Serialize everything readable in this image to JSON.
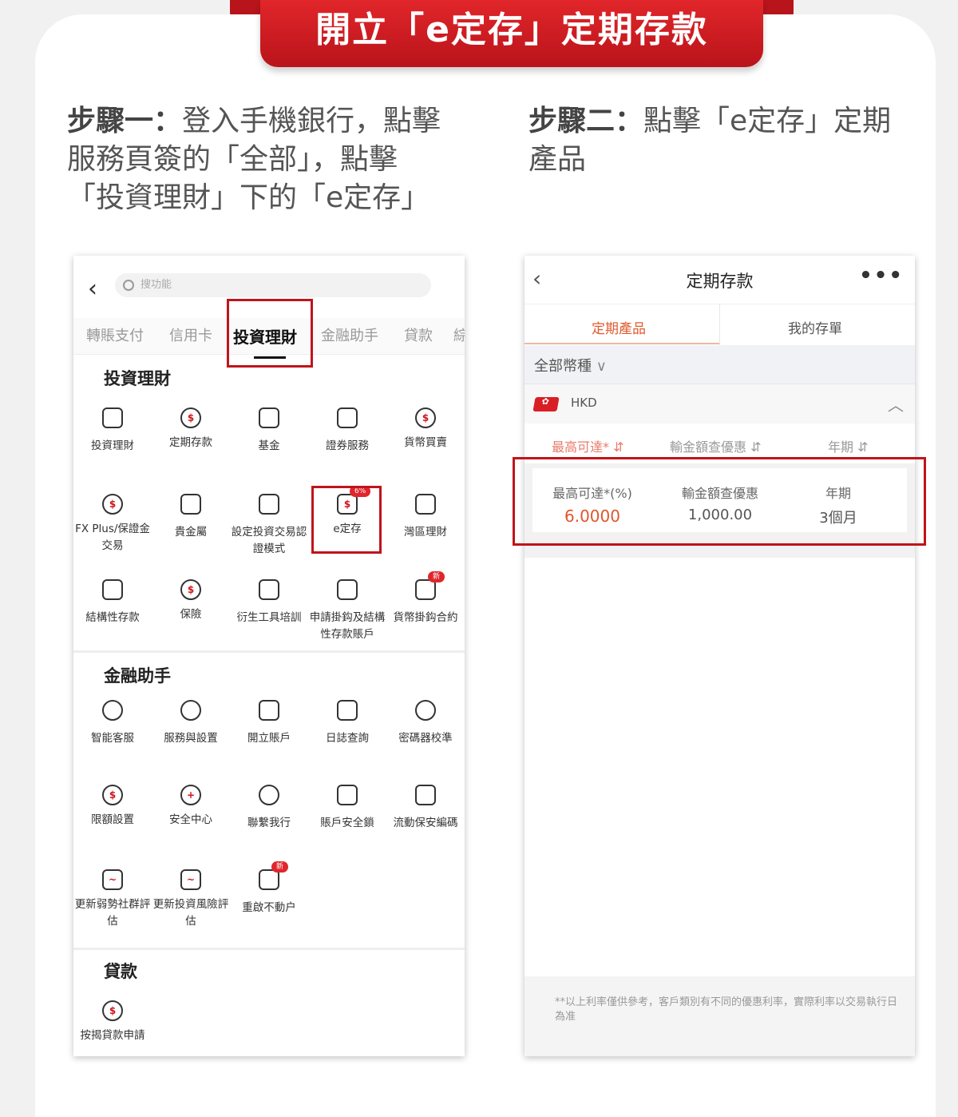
{
  "banner": {
    "title": "開立「e定存」定期存款"
  },
  "steps": [
    {
      "label": "步驟一：",
      "text": "登入手機銀行，點擊服務頁簽的「全部」，點擊「投資理財」下的「e定存」"
    },
    {
      "label": "步驟二：",
      "text": "點擊「e定存」定期產品"
    }
  ],
  "phone1": {
    "search_placeholder": "搜功能",
    "tabs": [
      "轉賬支付",
      "信用卡",
      "投資理財",
      "金融助手",
      "貸款",
      "綜"
    ],
    "sections": [
      {
        "title": "投資理財",
        "items": [
          {
            "label": "投資理財",
            "icon": "wallet-icon"
          },
          {
            "label": "定期存款",
            "icon": "timer-icon"
          },
          {
            "label": "基金",
            "icon": "chart-icon"
          },
          {
            "label": "證券服務",
            "icon": "trend-icon"
          },
          {
            "label": "貨幣買賣",
            "icon": "exchange-icon"
          },
          {
            "label": "FX Plus/保證金交易",
            "icon": "shield-dollar-icon"
          },
          {
            "label": "貴金屬",
            "icon": "gold-bars-icon"
          },
          {
            "label": "設定投資交易認證模式",
            "icon": "settings-card-icon"
          },
          {
            "label": "e定存",
            "icon": "calendar-dollar-icon",
            "badge": "6%"
          },
          {
            "label": "灣區理財",
            "icon": "bay-icon"
          },
          {
            "label": "結構性存款",
            "icon": "box-icon"
          },
          {
            "label": "保險",
            "icon": "insurance-icon"
          },
          {
            "label": "衍生工具培訓",
            "icon": "video-icon"
          },
          {
            "label": "申請掛鈎及結構性存款賬戶",
            "icon": "document-icon"
          },
          {
            "label": "貨幣掛鈎合約",
            "icon": "contract-icon",
            "badge": "新"
          }
        ]
      },
      {
        "title": "金融助手",
        "items": [
          {
            "label": "智能客服",
            "icon": "headset-icon"
          },
          {
            "label": "服務與設置",
            "icon": "gear-icon"
          },
          {
            "label": "開立賬戶",
            "icon": "clipboard-icon"
          },
          {
            "label": "日誌查詢",
            "icon": "log-icon"
          },
          {
            "label": "密碼器校準",
            "icon": "target-icon"
          },
          {
            "label": "限額設置",
            "icon": "limit-icon"
          },
          {
            "label": "安全中心",
            "icon": "shield-plus-icon"
          },
          {
            "label": "聯繫我行",
            "icon": "phone-icon"
          },
          {
            "label": "賬戶安全鎖",
            "icon": "lock-icon"
          },
          {
            "label": "流動保安編碼",
            "icon": "keypad-icon"
          },
          {
            "label": "更新弱勢社群評估",
            "icon": "heart-shield-icon"
          },
          {
            "label": "更新投資風險評估",
            "icon": "risk-icon"
          },
          {
            "label": "重啟不動户",
            "icon": "reactivate-icon",
            "badge": "新"
          }
        ]
      },
      {
        "title": "貸款",
        "items": [
          {
            "label": "按揭貸款申請",
            "icon": "mortgage-icon"
          }
        ]
      }
    ]
  },
  "phone2": {
    "title": "定期存款",
    "tabs": [
      "定期產品",
      "我的存單"
    ],
    "filter": "全部幣種",
    "currency": "HKD",
    "columns": [
      "最高可達*",
      "輸金額查優惠",
      "年期"
    ],
    "product": {
      "rate_label": "最高可達*(%)",
      "rate_value": "6.0000",
      "amount_label": "輸金額查優惠",
      "amount_value": "1,000.00",
      "term_label": "年期",
      "term_value": "3個月"
    },
    "footnote": "**以上利率僅供參考，客戶類別有不同的優惠利率，實際利率以交易執行日為准"
  },
  "colors": {
    "brand_red": "#c0141b",
    "rate_orange": "#e0562d"
  }
}
